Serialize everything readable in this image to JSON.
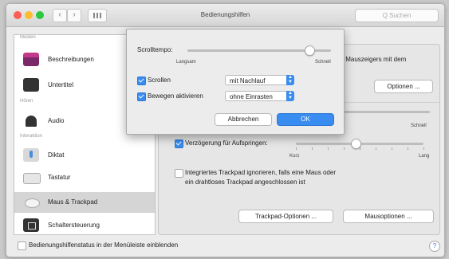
{
  "window": {
    "title": "Bedienungshilfen",
    "search_placeholder": "Q Suchen"
  },
  "sidebar": {
    "sections": {
      "medien": "Medien",
      "hoeren": "Hören",
      "interaktion": "Interaktion"
    },
    "items": [
      {
        "label": "Beschreibungen",
        "icon": "descriptions-icon"
      },
      {
        "label": "Untertitel",
        "icon": "subtitles-icon"
      },
      {
        "label": "Audio",
        "icon": "audio-icon"
      },
      {
        "label": "Diktat",
        "icon": "microphone-icon"
      },
      {
        "label": "Tastatur",
        "icon": "keyboard-icon"
      },
      {
        "label": "Maus & Trackpad",
        "icon": "mouse-icon",
        "selected": true
      },
      {
        "label": "Schaltersteuerung",
        "icon": "switch-control-icon"
      }
    ]
  },
  "content": {
    "partial_text_line1": "s Mauszeigers mit dem",
    "optionen_button": "Optionen ...",
    "speed_right_label": "Schnell",
    "delay_checkbox_label": "Verzögerung für Aufspringen:",
    "delay_checked": true,
    "delay_left": "Kurz",
    "delay_right": "Lang",
    "delay_level": 0.47,
    "trackpad_ignore_line1": "Integriertes Trackpad ignorieren, falls eine Maus oder",
    "trackpad_ignore_line2": "ein drahtloses Trackpad angeschlossen ist",
    "trackpad_ignore_checked": false,
    "trackpad_options_button": "Trackpad-Optionen ...",
    "mouse_options_button": "Mausoptionen ..."
  },
  "footer": {
    "status_label": "Bedienungshilfenstatus in der Menüleiste einblenden",
    "status_checked": false,
    "help": "?"
  },
  "dialog": {
    "scroll_speed_label": "Scrolltempo:",
    "scroll_slow": "Langsam",
    "scroll_fast": "Schnell",
    "scroll_level": 0.85,
    "scroll_checkbox_label": "Scrollen",
    "scroll_checked": true,
    "scroll_select_value": "mit Nachlauf",
    "move_checkbox_label": "Bewegen aktivieren",
    "move_checked": true,
    "move_select_value": "ohne Einrasten",
    "cancel_button": "Abbrechen",
    "ok_button": "OK"
  },
  "colors": {
    "accent": "#3a8df0",
    "close": "#fc5f57",
    "minimize": "#fdbc2e",
    "zoom": "#2ac840"
  }
}
